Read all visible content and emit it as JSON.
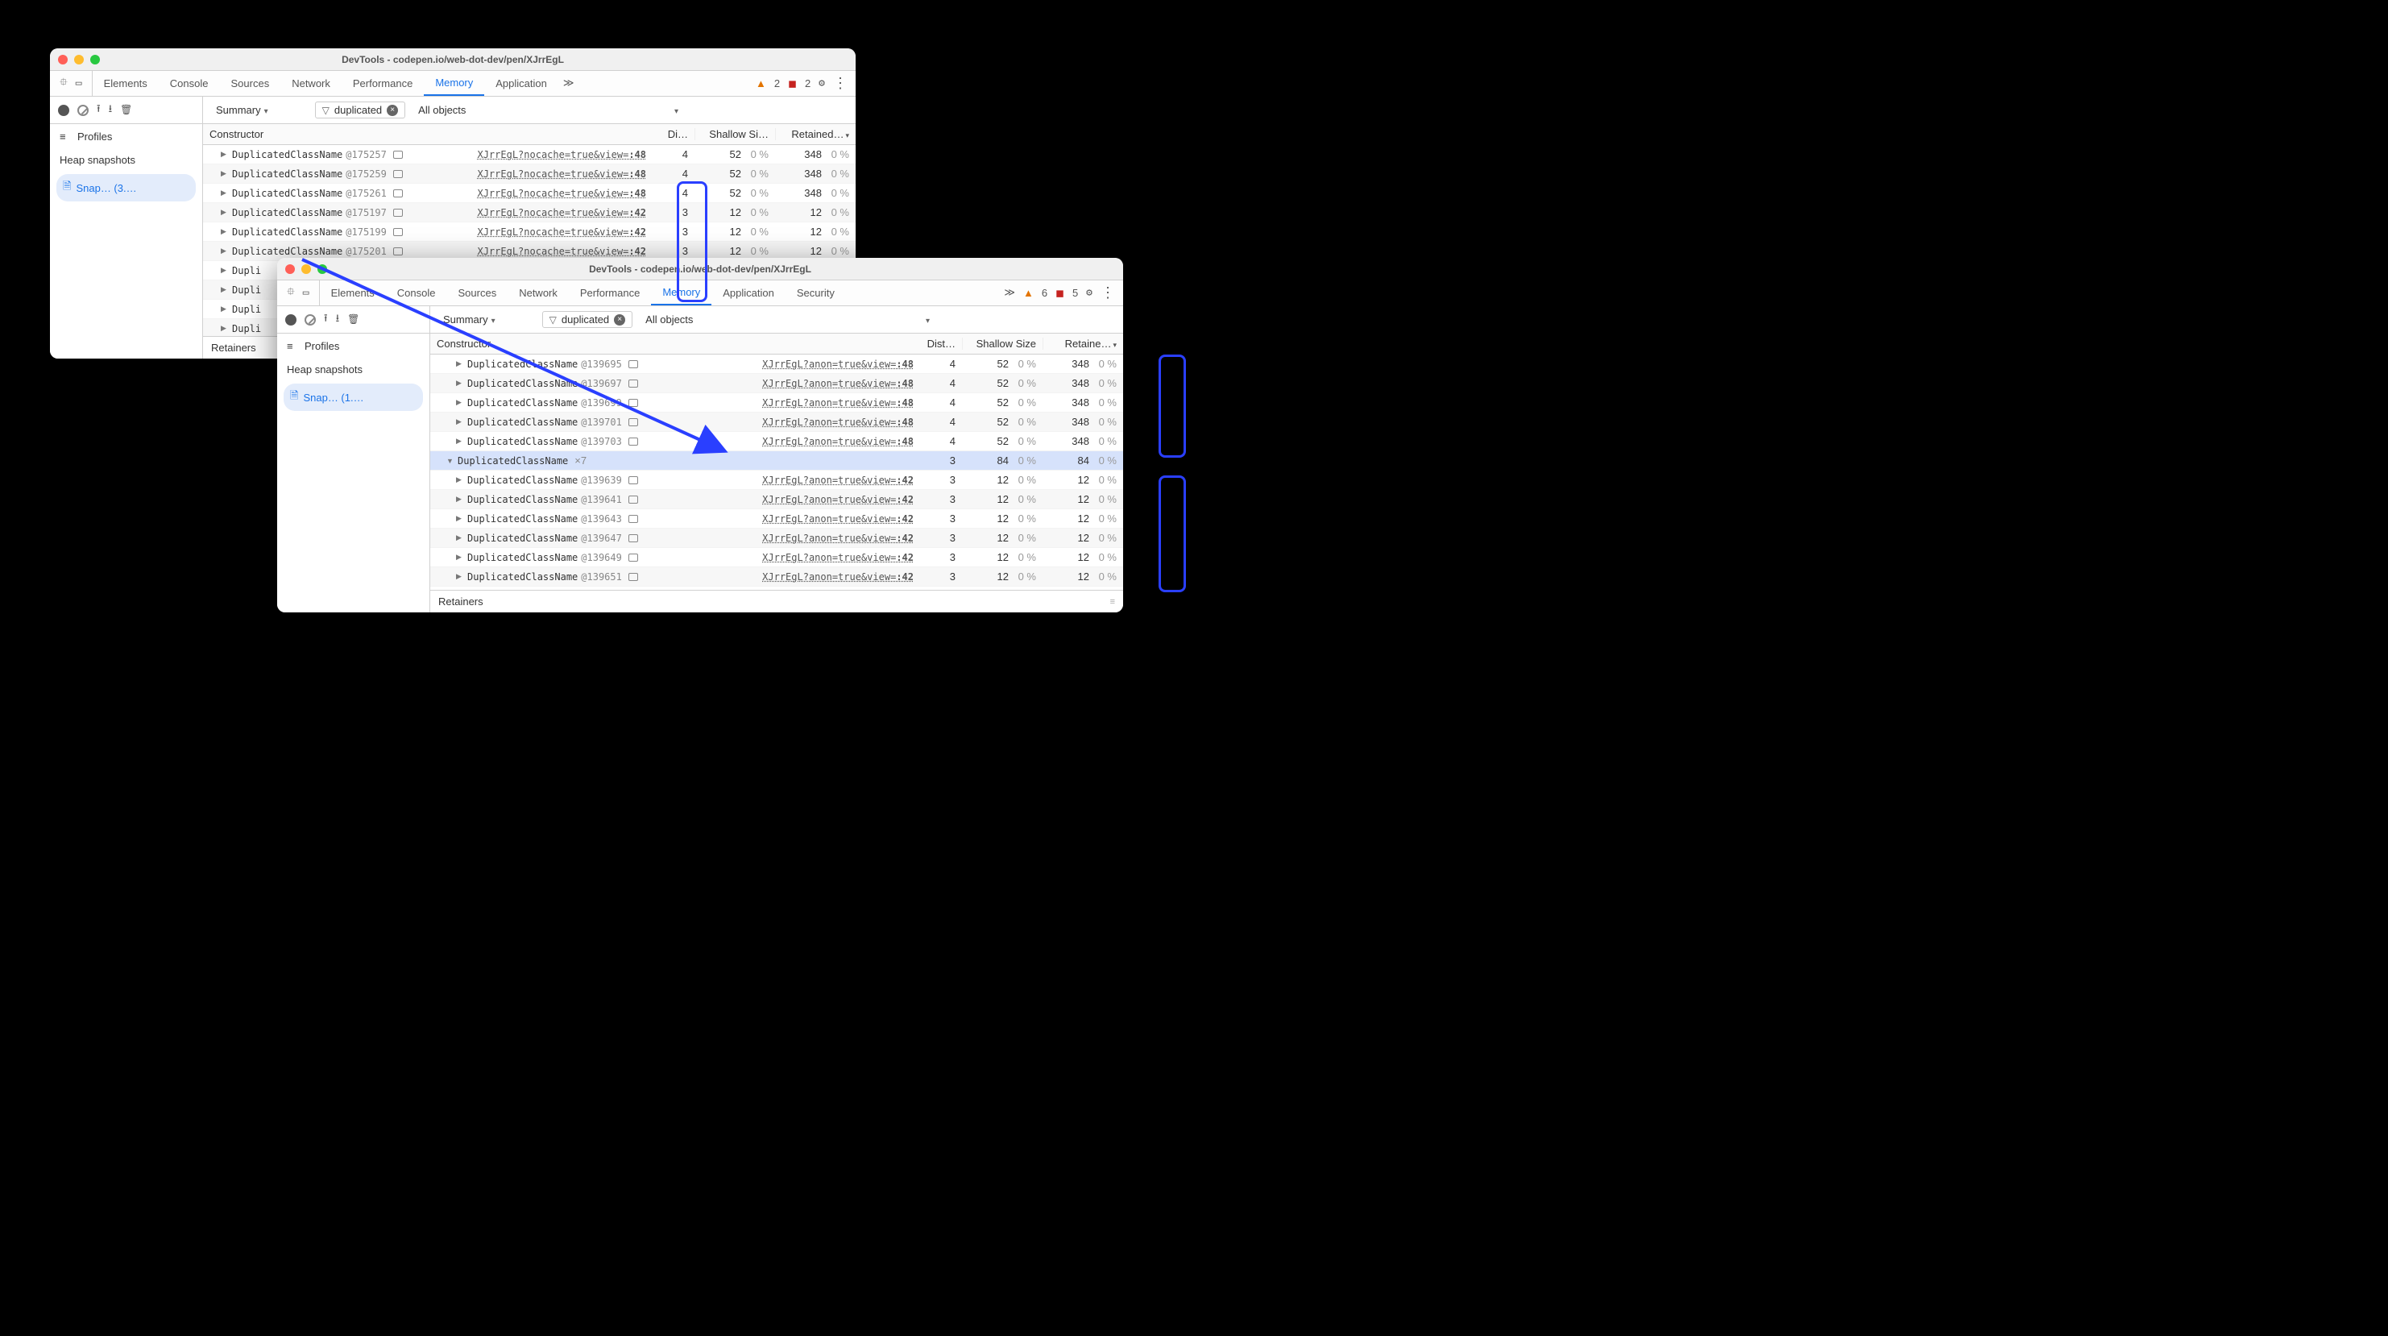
{
  "back": {
    "title": "DevTools - codepen.io/web-dot-dev/pen/XJrrEgL",
    "tabs": [
      "Elements",
      "Console",
      "Sources",
      "Network",
      "Performance",
      "Memory",
      "Application"
    ],
    "active_tab": "Memory",
    "warn_count": 2,
    "err_count": 2,
    "sidebar": {
      "profiles_label": "Profiles",
      "section": "Heap snapshots",
      "item": "Snap…  (3.…"
    },
    "filterbar": {
      "summary": "Summary",
      "filter": "duplicated",
      "objects": "All objects"
    },
    "headers": {
      "constructor": "Constructor",
      "dist": "Di…",
      "shallow": "Shallow Si…",
      "retained": "Retained…"
    },
    "rows": [
      {
        "name": "DuplicatedClassName",
        "id": "@175257",
        "link": "XJrrEgL?nocache=true&view=",
        "ln": ":48",
        "dist": 4,
        "sh": 52,
        "shp": "0 %",
        "rt": 348,
        "rtp": "0 %"
      },
      {
        "name": "DuplicatedClassName",
        "id": "@175259",
        "link": "XJrrEgL?nocache=true&view=",
        "ln": ":48",
        "dist": 4,
        "sh": 52,
        "shp": "0 %",
        "rt": 348,
        "rtp": "0 %"
      },
      {
        "name": "DuplicatedClassName",
        "id": "@175261",
        "link": "XJrrEgL?nocache=true&view=",
        "ln": ":48",
        "dist": 4,
        "sh": 52,
        "shp": "0 %",
        "rt": 348,
        "rtp": "0 %"
      },
      {
        "name": "DuplicatedClassName",
        "id": "@175197",
        "link": "XJrrEgL?nocache=true&view=",
        "ln": ":42",
        "dist": 3,
        "sh": 12,
        "shp": "0 %",
        "rt": 12,
        "rtp": "0 %"
      },
      {
        "name": "DuplicatedClassName",
        "id": "@175199",
        "link": "XJrrEgL?nocache=true&view=",
        "ln": ":42",
        "dist": 3,
        "sh": 12,
        "shp": "0 %",
        "rt": 12,
        "rtp": "0 %"
      },
      {
        "name": "DuplicatedClassName",
        "id": "@175201",
        "link": "XJrrEgL?nocache=true&view=",
        "ln": ":42",
        "dist": 3,
        "sh": 12,
        "shp": "0 %",
        "rt": 12,
        "rtp": "0 %"
      },
      {
        "name": "Dupli",
        "partial": true
      },
      {
        "name": "Dupli",
        "partial": true
      },
      {
        "name": "Dupli",
        "partial": true
      },
      {
        "name": "Dupli",
        "partial": true
      }
    ],
    "retainers": "Retainers"
  },
  "front": {
    "title": "DevTools - codepen.io/web-dot-dev/pen/XJrrEgL",
    "tabs": [
      "Elements",
      "Console",
      "Sources",
      "Network",
      "Performance",
      "Memory",
      "Application",
      "Security"
    ],
    "active_tab": "Memory",
    "warn_count": 6,
    "err_count": 5,
    "sidebar": {
      "profiles_label": "Profiles",
      "section": "Heap snapshots",
      "item": "Snap…  (1.…"
    },
    "filterbar": {
      "summary": "Summary",
      "filter": "duplicated",
      "objects": "All objects"
    },
    "headers": {
      "constructor": "Constructor",
      "dist": "Dist…",
      "shallow": "Shallow Size",
      "retained": "Retaine…"
    },
    "rows": [
      {
        "name": "DuplicatedClassName",
        "id": "@139695",
        "link": "XJrrEgL?anon=true&view=",
        "ln": ":48",
        "dist": 4,
        "sh": 52,
        "shp": "0 %",
        "rt": 348,
        "rtp": "0 %"
      },
      {
        "name": "DuplicatedClassName",
        "id": "@139697",
        "link": "XJrrEgL?anon=true&view=",
        "ln": ":48",
        "dist": 4,
        "sh": 52,
        "shp": "0 %",
        "rt": 348,
        "rtp": "0 %"
      },
      {
        "name": "DuplicatedClassName",
        "id": "@139699",
        "link": "XJrrEgL?anon=true&view=",
        "ln": ":48",
        "dist": 4,
        "sh": 52,
        "shp": "0 %",
        "rt": 348,
        "rtp": "0 %"
      },
      {
        "name": "DuplicatedClassName",
        "id": "@139701",
        "link": "XJrrEgL?anon=true&view=",
        "ln": ":48",
        "dist": 4,
        "sh": 52,
        "shp": "0 %",
        "rt": 348,
        "rtp": "0 %"
      },
      {
        "name": "DuplicatedClassName",
        "id": "@139703",
        "link": "XJrrEgL?anon=true&view=",
        "ln": ":48",
        "dist": 4,
        "sh": 52,
        "shp": "0 %",
        "rt": 348,
        "rtp": "0 %"
      },
      {
        "group": true,
        "name": "DuplicatedClassName",
        "xn": "×7",
        "dist": 3,
        "sh": 84,
        "shp": "0 %",
        "rt": 84,
        "rtp": "0 %"
      },
      {
        "name": "DuplicatedClassName",
        "id": "@139639",
        "link": "XJrrEgL?anon=true&view=",
        "ln": ":42",
        "dist": 3,
        "sh": 12,
        "shp": "0 %",
        "rt": 12,
        "rtp": "0 %"
      },
      {
        "name": "DuplicatedClassName",
        "id": "@139641",
        "link": "XJrrEgL?anon=true&view=",
        "ln": ":42",
        "dist": 3,
        "sh": 12,
        "shp": "0 %",
        "rt": 12,
        "rtp": "0 %"
      },
      {
        "name": "DuplicatedClassName",
        "id": "@139643",
        "link": "XJrrEgL?anon=true&view=",
        "ln": ":42",
        "dist": 3,
        "sh": 12,
        "shp": "0 %",
        "rt": 12,
        "rtp": "0 %"
      },
      {
        "name": "DuplicatedClassName",
        "id": "@139647",
        "link": "XJrrEgL?anon=true&view=",
        "ln": ":42",
        "dist": 3,
        "sh": 12,
        "shp": "0 %",
        "rt": 12,
        "rtp": "0 %"
      },
      {
        "name": "DuplicatedClassName",
        "id": "@139649",
        "link": "XJrrEgL?anon=true&view=",
        "ln": ":42",
        "dist": 3,
        "sh": 12,
        "shp": "0 %",
        "rt": 12,
        "rtp": "0 %"
      },
      {
        "name": "DuplicatedClassName",
        "id": "@139651",
        "link": "XJrrEgL?anon=true&view=",
        "ln": ":42",
        "dist": 3,
        "sh": 12,
        "shp": "0 %",
        "rt": 12,
        "rtp": "0 %"
      }
    ],
    "retainers": "Retainers"
  }
}
